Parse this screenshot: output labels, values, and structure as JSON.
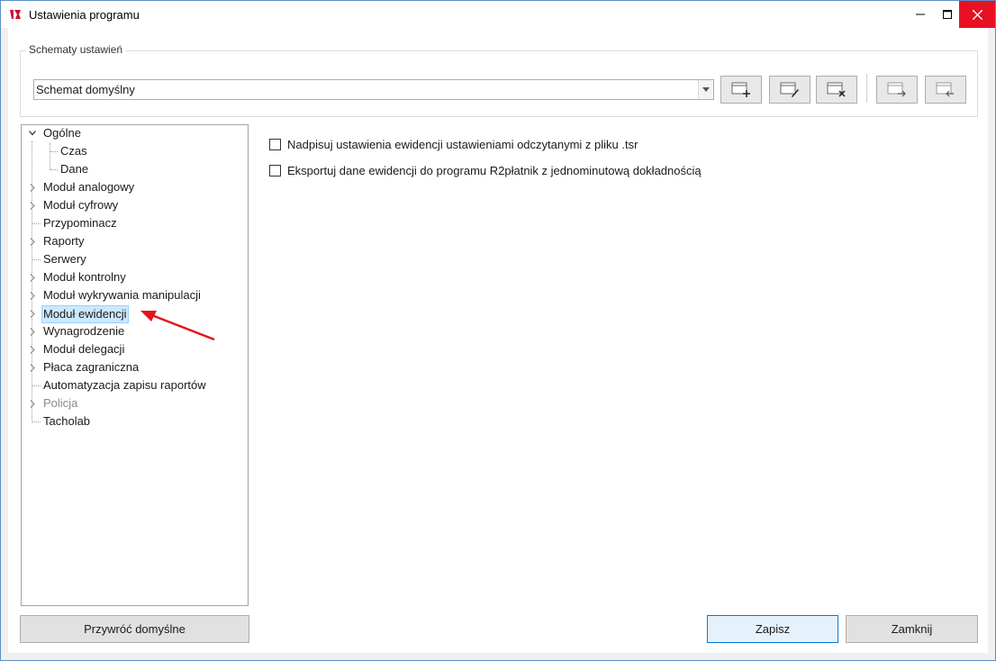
{
  "window": {
    "title": "Ustawienia programu",
    "icon": "app-logo-icon",
    "controls": [
      "minimize-icon",
      "maximize-icon",
      "close-icon"
    ]
  },
  "schemes": {
    "legend": "Schematy ustawień",
    "selected": "Schemat domyślny",
    "buttons": [
      "add-scheme-icon",
      "edit-scheme-icon",
      "delete-scheme-icon",
      "export-scheme-icon",
      "import-scheme-icon"
    ]
  },
  "tree": {
    "items": [
      {
        "label": "Ogólne",
        "expanded": true
      },
      {
        "label": "Czas"
      },
      {
        "label": "Dane"
      },
      {
        "label": "Moduł analogowy",
        "expandable": true
      },
      {
        "label": "Moduł cyfrowy",
        "expandable": true
      },
      {
        "label": "Przypominacz"
      },
      {
        "label": "Raporty",
        "expandable": true
      },
      {
        "label": "Serwery"
      },
      {
        "label": "Moduł kontrolny",
        "expandable": true
      },
      {
        "label": "Moduł wykrywania manipulacji",
        "expandable": true
      },
      {
        "label": "Moduł ewidencji",
        "expandable": true,
        "selected": true
      },
      {
        "label": "Wynagrodzenie",
        "expandable": true
      },
      {
        "label": "Moduł delegacji",
        "expandable": true
      },
      {
        "label": "Płaca zagraniczna",
        "expandable": true
      },
      {
        "label": "Automatyzacja zapisu raportów"
      },
      {
        "label": "Policja",
        "expandable": true,
        "disabled": true
      },
      {
        "label": "Tacholab"
      }
    ]
  },
  "options": [
    {
      "label": "Nadpisuj ustawienia ewidencji ustawieniami odczytanymi z pliku .tsr",
      "checked": false
    },
    {
      "label": "Eksportuj dane ewidencji do programu R2płatnik z jednominutową dokładnością",
      "checked": false
    }
  ],
  "footer": {
    "restore_label": "Przywróć domyślne",
    "save_label": "Zapisz",
    "close_label": "Zamknij"
  },
  "colors": {
    "selection": "#cce8ff",
    "close_button": "#e81123",
    "annotation_arrow": "#e3141a"
  }
}
